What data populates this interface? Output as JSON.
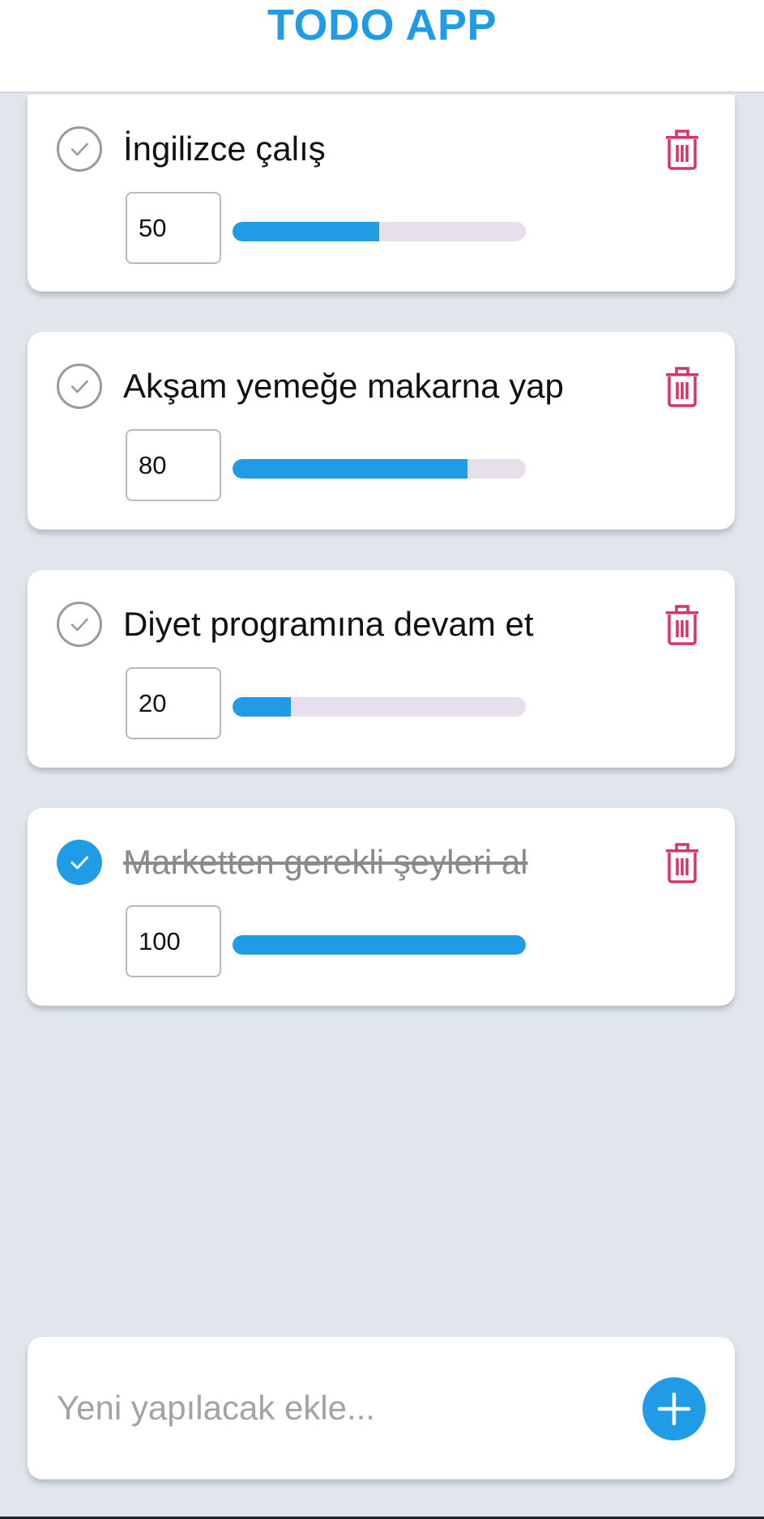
{
  "header": {
    "title": "TODO APP"
  },
  "colors": {
    "accent": "#209ce6",
    "delete": "#d9316b",
    "background": "#e1e6ed",
    "track": "#e6e0ec"
  },
  "todos": [
    {
      "text": "İngilizce çalış",
      "progress": "50",
      "completed": false
    },
    {
      "text": "Akşam yemeğe makarna yap",
      "progress": "80",
      "completed": false
    },
    {
      "text": "Diyet programına devam et",
      "progress": "20",
      "completed": false
    },
    {
      "text": "Marketten gerekli şeyleri al",
      "progress": "100",
      "completed": true
    }
  ],
  "icons": {
    "check": "check-circle-icon",
    "delete": "trash-icon",
    "add": "plus-icon"
  },
  "add_form": {
    "placeholder": "Yeni yapılacak ekle...",
    "value": ""
  }
}
